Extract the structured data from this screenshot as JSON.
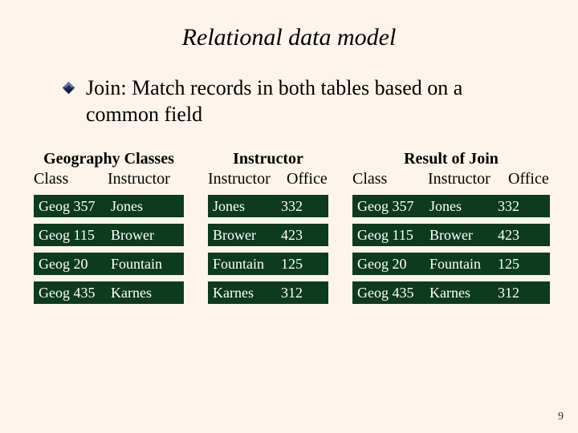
{
  "title": "Relational data model",
  "bullet": "Join: Match records in both tables based on a common field",
  "tables": {
    "classes": {
      "title": "Geography Classes",
      "headers": [
        "Class",
        "Instructor"
      ],
      "rows": [
        [
          "Geog 357",
          "Jones"
        ],
        [
          "Geog 115",
          "Brower"
        ],
        [
          "Geog 20",
          "Fountain"
        ],
        [
          "Geog 435",
          "Karnes"
        ]
      ]
    },
    "instructor": {
      "title": "Instructor",
      "headers": [
        "Instructor",
        "Office"
      ],
      "rows": [
        [
          "Jones",
          "332"
        ],
        [
          "Brower",
          "423"
        ],
        [
          "Fountain",
          "125"
        ],
        [
          "Karnes",
          "312"
        ]
      ]
    },
    "result": {
      "title": "Result of Join",
      "headers": [
        "Class",
        "Instructor",
        "Office"
      ],
      "rows": [
        [
          "Geog 357",
          "Jones",
          "332"
        ],
        [
          "Geog 115",
          "Brower",
          "423"
        ],
        [
          "Geog 20",
          "Fountain",
          "125"
        ],
        [
          "Geog 435",
          "Karnes",
          "312"
        ]
      ]
    }
  },
  "page_number": "9"
}
